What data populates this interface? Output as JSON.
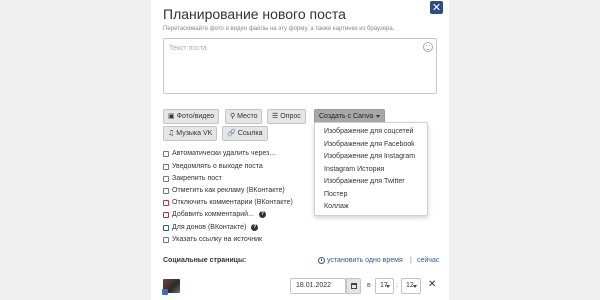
{
  "dialog": {
    "title": "Планирование нового поста",
    "hint": "Перетаскивайте фото и видео файлы на эту форму, а также картинки из браузера.",
    "close_glyph": "✕"
  },
  "post": {
    "placeholder": "Текст поста",
    "value": ""
  },
  "toolbar": {
    "photo_video": "Фото/видео",
    "place": "Место",
    "poll": "Опрос",
    "canva": "Создать с Canva",
    "music": "Музыка VK",
    "link": "Ссылка"
  },
  "canva_menu": [
    "Изображение для соцсетей",
    "Изображение для Facebook",
    "Изображение для Instagram",
    "Instagram История",
    "Изображение для Twitter",
    "Постер",
    "Коллаж"
  ],
  "options": [
    {
      "label": "Автоматически удалить через...",
      "style": "normal",
      "help": false
    },
    {
      "label": "Уведомлять о выходе поста",
      "style": "normal",
      "help": false
    },
    {
      "label": "Закрепить пост",
      "style": "normal",
      "help": false
    },
    {
      "label": "Отметить как рекламу (ВКонтакте)",
      "style": "normal",
      "help": false
    },
    {
      "label": "Отключить комментарии (ВКонтакте)",
      "style": "red",
      "help": false
    },
    {
      "label": "Добавить комментарий...",
      "style": "red",
      "help": true
    },
    {
      "label": "Для донов (ВКонтакте)",
      "style": "blue",
      "help": true
    },
    {
      "label": "Указать ссылку на источник",
      "style": "normal",
      "help": false
    }
  ],
  "social": {
    "label": "Социальные страницы:",
    "set_one_time": "установить одно время",
    "separator": "|",
    "now": "сейчас"
  },
  "schedule": {
    "date": "18.01.2022",
    "at": "в",
    "hour": "17",
    "colon": ":",
    "minute": "12",
    "remove_glyph": "✕"
  },
  "colors": {
    "accent": "#2b4f80",
    "link": "#2b5b9a",
    "red_border": "#b03a3a",
    "blue_border": "#2d5a9a"
  }
}
